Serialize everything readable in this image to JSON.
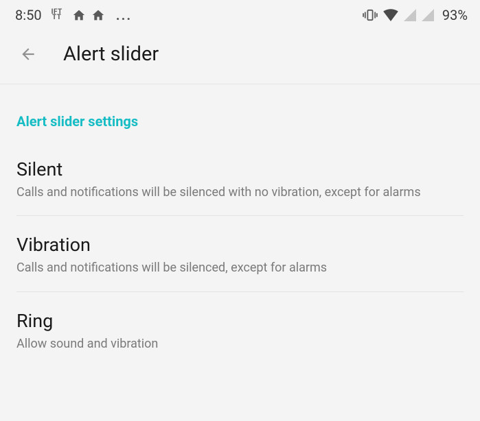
{
  "status": {
    "time": "8:50",
    "ift_top": "IFT",
    "ift_bottom": "TT",
    "dots": "...",
    "battery": "93%"
  },
  "header": {
    "title": "Alert slider"
  },
  "section": {
    "label": "Alert slider settings"
  },
  "items": [
    {
      "title": "Silent",
      "subtitle": "Calls and notifications will be silenced with no vibration, except for alarms"
    },
    {
      "title": "Vibration",
      "subtitle": "Calls and notifications will be silenced, except for alarms"
    },
    {
      "title": "Ring",
      "subtitle": "Allow sound and vibration"
    }
  ]
}
